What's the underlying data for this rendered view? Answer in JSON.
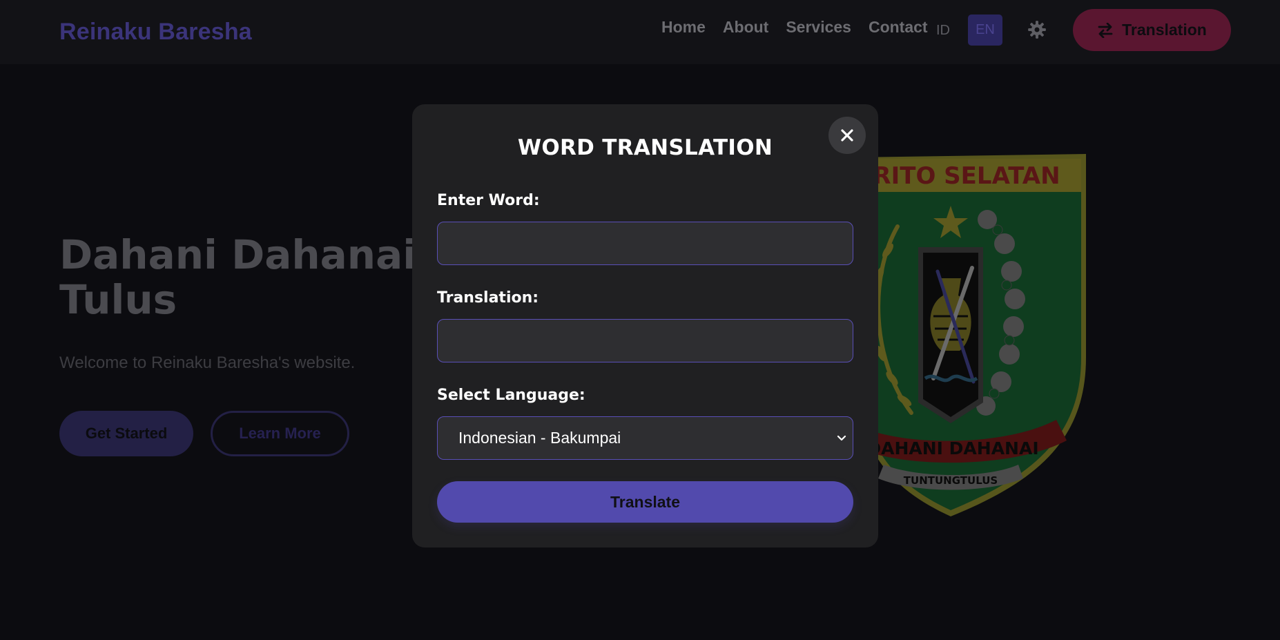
{
  "navbar": {
    "brand": "Reinaku Baresha",
    "links": [
      "Home",
      "About",
      "Services",
      "Contact"
    ],
    "lang_id": "ID",
    "lang_en": "EN",
    "translation_button": "Translation"
  },
  "hero": {
    "title_line1": "Dahani Dahanai Tu",
    "title_line2": "Tulus",
    "subtitle": "Welcome to Reinaku Baresha's website.",
    "primary_button": "Get Started",
    "secondary_button": "Learn More"
  },
  "emblem": {
    "banner_top": "RITO SELATAN",
    "ribbon": "DAHANI DAHANAI",
    "motto": "TUNTUNGTULUS"
  },
  "modal": {
    "title": "WORD TRANSLATION",
    "word_label": "Enter Word:",
    "word_value": "",
    "translation_label": "Translation:",
    "translation_value": "",
    "language_label": "Select Language:",
    "language_selected": "Indonesian - Bakumpai",
    "translate_button": "Translate"
  },
  "colors": {
    "accent": "#524aad",
    "modal_bg": "#202022",
    "input_border": "#5a4fb8",
    "translation_btn": "#5a1630"
  },
  "icons": {
    "close": "close-icon",
    "settings": "gear-icon",
    "swap": "swap-arrows-icon",
    "dropdown": "chevron-down-icon"
  }
}
